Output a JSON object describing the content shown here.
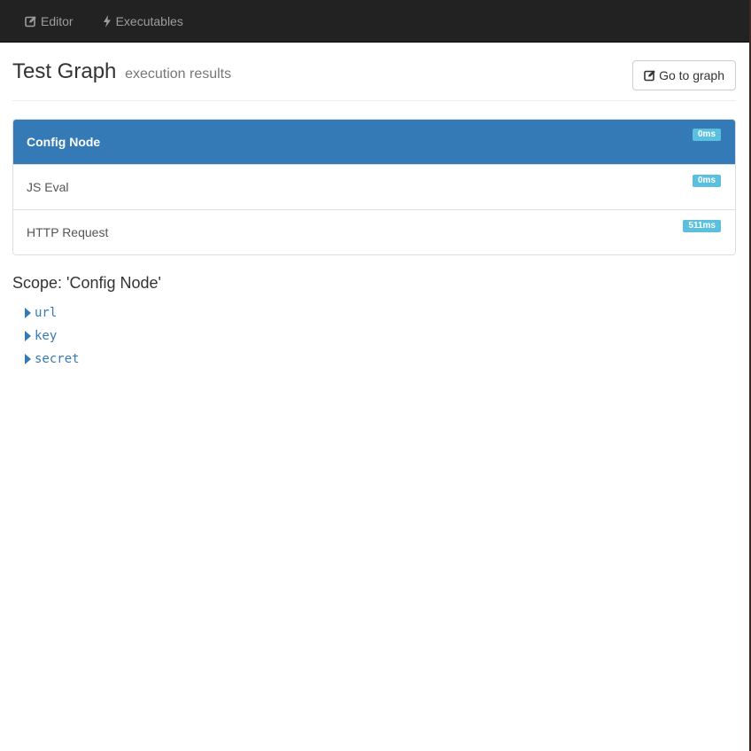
{
  "navbar": {
    "items": [
      {
        "label": "Editor",
        "icon": "edit-icon"
      },
      {
        "label": "Executables",
        "icon": "bolt-icon"
      }
    ]
  },
  "header": {
    "title": "Test Graph",
    "subtitle": "execution results",
    "goto_button": "Go to graph"
  },
  "nodes": [
    {
      "label": "Config Node",
      "time": "0ms",
      "active": true
    },
    {
      "label": "JS Eval",
      "time": "0ms",
      "active": false
    },
    {
      "label": "HTTP Request",
      "time": "511ms",
      "active": false
    }
  ],
  "scope": {
    "title": "Scope: 'Config Node'",
    "keys": [
      "url",
      "key",
      "secret"
    ]
  },
  "colors": {
    "navbar_bg": "#222222",
    "active_bg": "#337ab7",
    "badge_bg": "#5bc0de",
    "link": "#337ab7"
  }
}
